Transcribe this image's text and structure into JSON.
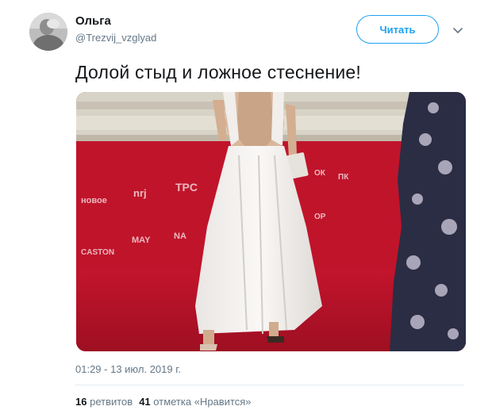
{
  "user": {
    "name": "Ольга",
    "handle": "@Trezvij_vzglyad"
  },
  "follow_label": "Читать",
  "tweet_text": "Долой стыд и ложное стеснение!",
  "timestamp": "01:29 - 13 июл. 2019 г.",
  "stats": {
    "retweets_count": "16",
    "retweets_label": "ретвитов",
    "likes_count": "41",
    "likes_label": "отметка «Нравится»"
  },
  "icons": {
    "more": "chevron-down-icon"
  },
  "colors": {
    "accent": "#1da1f2",
    "text": "#14171a",
    "secondary": "#657786",
    "carpet": "#b3122a"
  }
}
